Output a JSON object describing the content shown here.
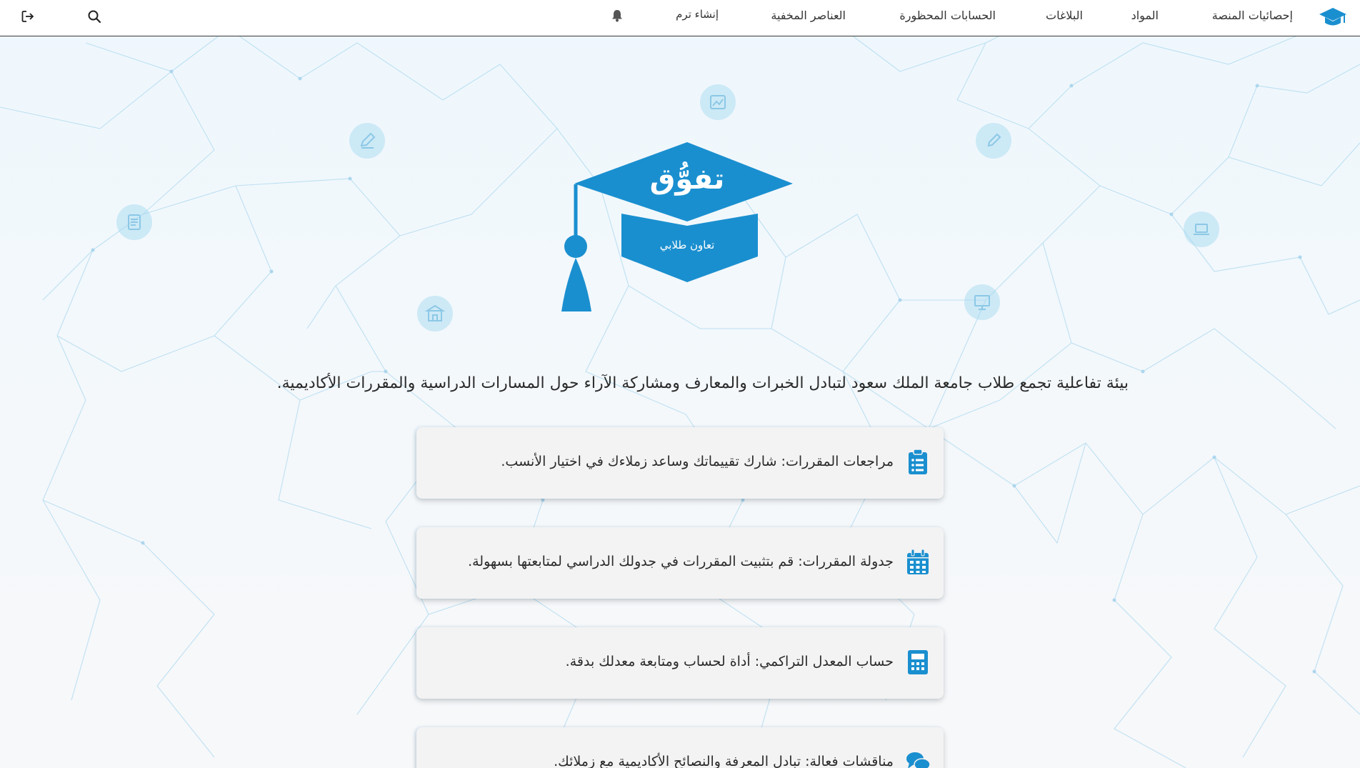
{
  "navbar": {
    "items": [
      {
        "label": "إحصائيات المنصة"
      },
      {
        "label": "المواد"
      },
      {
        "label": "البلاغات"
      },
      {
        "label": "الحسابات المحظورة"
      },
      {
        "label": "العناصر المخفية"
      },
      {
        "label": "إنشاء ترم"
      }
    ],
    "icons": [
      "graduation-cap-icon",
      "bell-icon",
      "search-icon",
      "logout-icon"
    ]
  },
  "hero": {
    "brand_title": "تفوُّق",
    "brand_subtitle": "تعاون طلابي",
    "tagline": "بيئة تفاعلية تجمع طلاب جامعة الملك سعود لتبادل الخبرات والمعارف ومشاركة الآراء حول المسارات الدراسية والمقررات الأكاديمية."
  },
  "features": [
    {
      "icon": "clipboard-list-icon",
      "text": "مراجعات المقررات: شارك تقييماتك وساعد زملاءك في اختيار الأنسب."
    },
    {
      "icon": "calendar-icon",
      "text": "جدولة المقررات: قم بتثبيت المقررات في جدولك الدراسي لمتابعتها بسهولة."
    },
    {
      "icon": "calculator-icon",
      "text": "حساب المعدل التراكمي: أداة لحساب ومتابعة معدلك بدقة."
    },
    {
      "icon": "comments-icon",
      "text": "مناقشات فعالة: تبادل المعرفة والنصائح الأكاديمية مع زملائك."
    }
  ],
  "colors": {
    "brand": "#1a8fcf",
    "text": "#2a2a2a",
    "card_bg": "#f3f3f4"
  }
}
